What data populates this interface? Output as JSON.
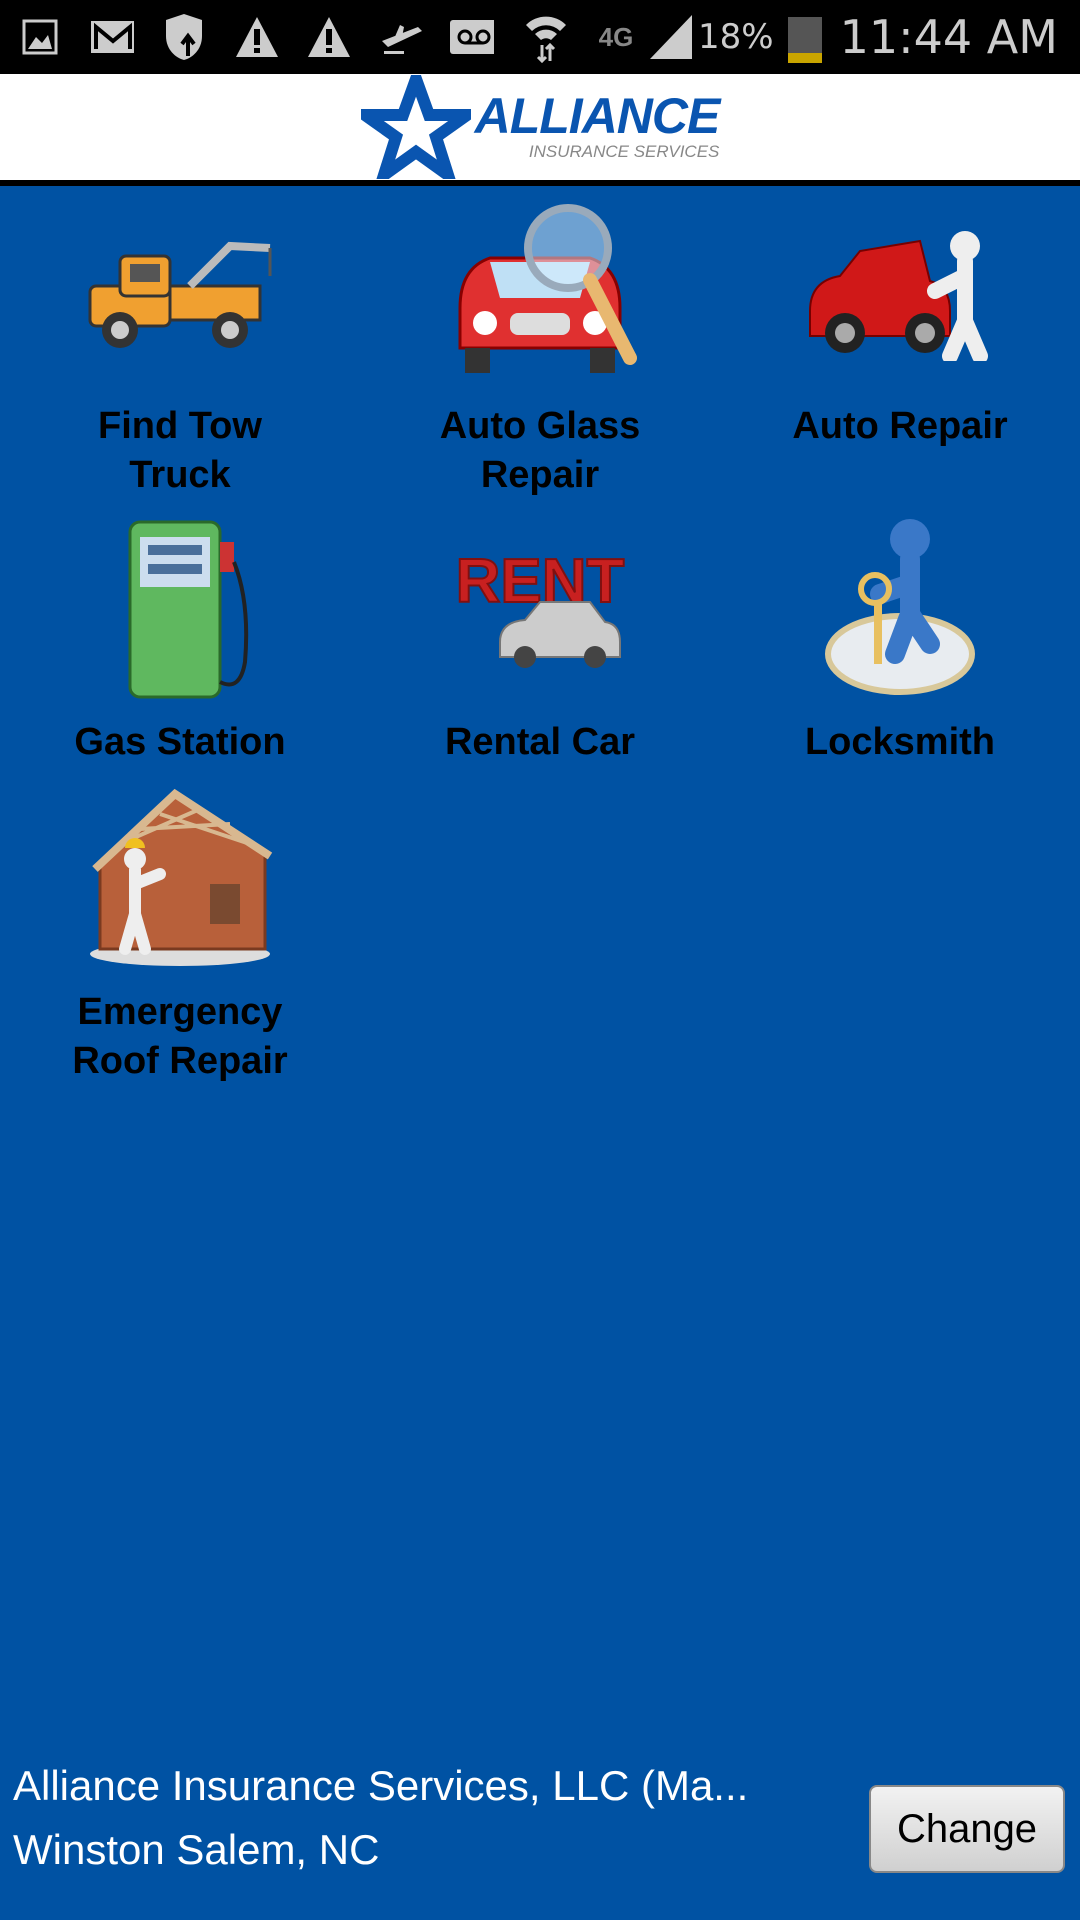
{
  "status_bar": {
    "icons": [
      "gallery-icon",
      "gmail-icon",
      "shield-update-icon",
      "warning-icon",
      "warning-icon",
      "airplane-icon",
      "voicemail-icon",
      "wifi-icon",
      "4g-lte-icon",
      "signal-icon"
    ],
    "network": "4G",
    "battery_percent": "18%",
    "battery_level": 0.18,
    "time": "11:44 AM"
  },
  "header": {
    "logo_title": "ALLIANCE",
    "logo_subtitle": "INSURANCE SERVICES"
  },
  "colors": {
    "background": "#0052a3",
    "logo_blue": "#0a55b0"
  },
  "services": [
    {
      "label": "Find Tow Truck",
      "icon": "tow-truck-icon"
    },
    {
      "label": "Auto Glass Repair",
      "icon": "car-magnifier-icon"
    },
    {
      "label": "Auto Repair",
      "icon": "car-mechanic-icon"
    },
    {
      "label": "Gas Station",
      "icon": "gas-pump-icon"
    },
    {
      "label": "Rental Car",
      "icon": "rent-car-icon"
    },
    {
      "label": "Locksmith",
      "icon": "key-person-icon"
    },
    {
      "label": "Emergency Roof Repair",
      "icon": "roof-repair-icon"
    }
  ],
  "footer": {
    "agency_name": "Alliance Insurance Services, LLC (Ma...",
    "location": "Winston Salem, NC",
    "change_label": "Change"
  }
}
